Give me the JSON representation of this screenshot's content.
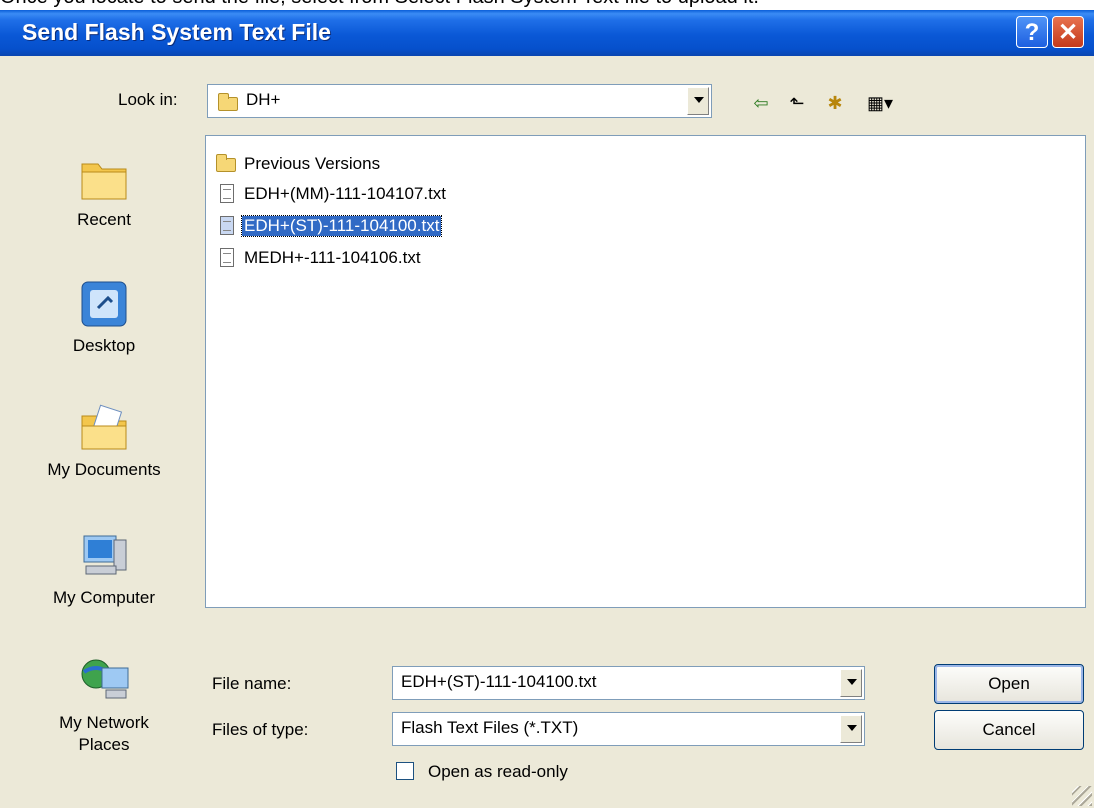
{
  "caption_text": "Once you locate to send the file, select from Select Flash System Text file to upload it.",
  "window": {
    "title": "Send Flash System Text File"
  },
  "titlebar_buttons": {
    "help": "?",
    "close": "✕"
  },
  "look_in": {
    "label": "Look in:",
    "value": "DH+"
  },
  "toolbar": {
    "back_glyph": "⇦",
    "up_glyph": "⬑",
    "new_folder_glyph": "✱",
    "views_glyph": "▦▾"
  },
  "places": [
    {
      "label": "Recent",
      "icon": "recent-folder-icon"
    },
    {
      "label": "Desktop",
      "icon": "desktop-icon"
    },
    {
      "label": "My Documents",
      "icon": "my-documents-icon"
    },
    {
      "label": "My Computer",
      "icon": "my-computer-icon"
    },
    {
      "label": "My Network Places",
      "icon": "network-places-icon"
    }
  ],
  "files": [
    {
      "name": "Previous Versions",
      "type": "folder",
      "selected": false
    },
    {
      "name": "EDH+(MM)-111-104107.txt",
      "type": "text",
      "selected": false
    },
    {
      "name": "EDH+(ST)-111-104100.txt",
      "type": "text",
      "selected": true
    },
    {
      "name": "MEDH+-111-104106.txt",
      "type": "text",
      "selected": false
    }
  ],
  "file_name": {
    "label": "File name:",
    "value": "EDH+(ST)-111-104100.txt"
  },
  "file_type": {
    "label": "Files of type:",
    "value": "Flash Text Files (*.TXT)"
  },
  "read_only": {
    "label": "Open as read-only",
    "checked": false
  },
  "buttons": {
    "open": "Open",
    "cancel": "Cancel"
  },
  "colors": {
    "titlebar": "#0a58d6",
    "selection": "#316ac5",
    "dialog_bg": "#ece9d8"
  }
}
